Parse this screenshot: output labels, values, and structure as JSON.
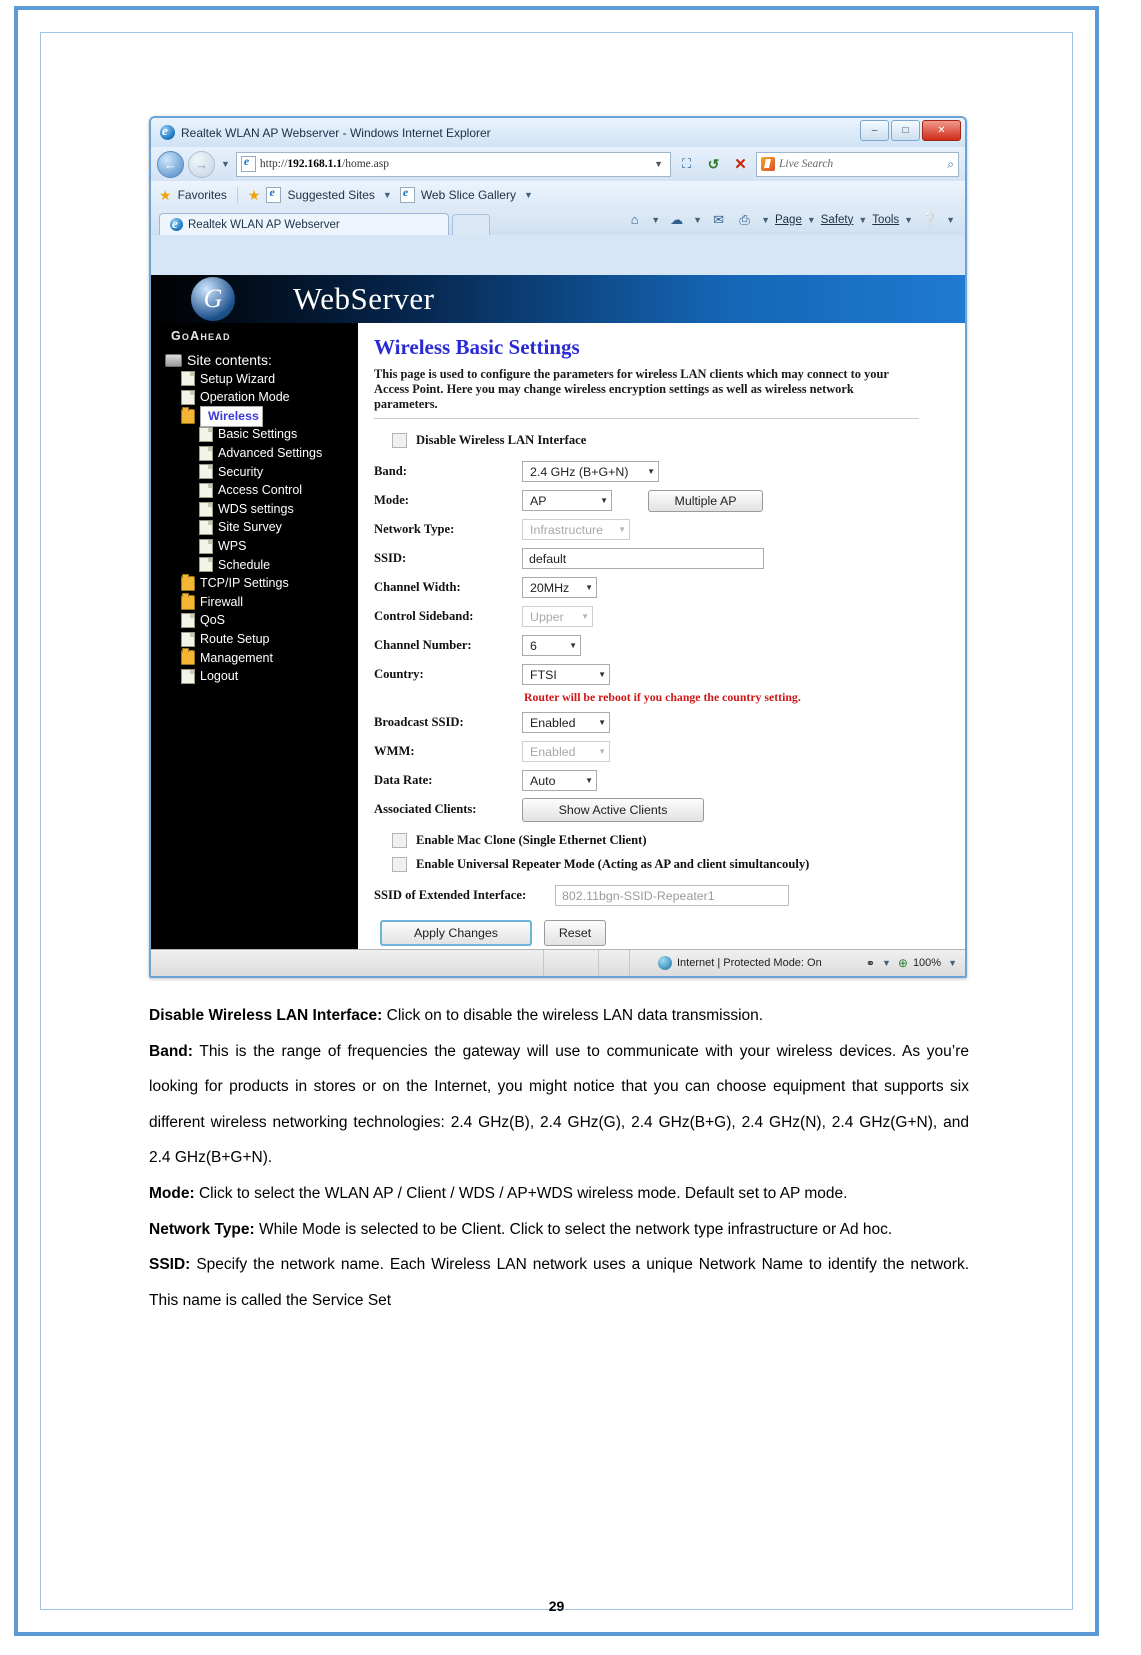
{
  "browser": {
    "window_title": "Realtek WLAN AP Webserver - Windows Internet Explorer",
    "minimize_label": "–",
    "maximize_label": "□",
    "close_label": "✕",
    "back_label": "←",
    "forward_label": "→",
    "url": "http://192.168.1.1/home.asp",
    "url_host": "192.168.1.1",
    "url_prefix": "http://",
    "url_path": "/home.asp",
    "compat_icon": "compatibility-view-icon",
    "refresh_label": "↺",
    "stop_label": "✕",
    "search_placeholder": "Live Search",
    "search_go_label": "⌕",
    "favorites_label": "Favorites",
    "suggested_sites_label": "Suggested Sites",
    "web_slice_label": "Web Slice Gallery",
    "tab_label": "Realtek WLAN AP Webserver",
    "commands": [
      "Page",
      "Safety",
      "Tools"
    ],
    "status_text": "Internet | Protected Mode: On",
    "zoom_level": "100%"
  },
  "app": {
    "brand": "GoAhead",
    "header_title": "WebServer",
    "sidebar": {
      "root_label": "Site contents:",
      "items": [
        {
          "label": "Setup Wizard",
          "icon": "document-icon",
          "level": 1,
          "selected": false
        },
        {
          "label": "Operation Mode",
          "icon": "document-icon",
          "level": 1,
          "selected": false
        },
        {
          "label": "Wireless",
          "icon": "folder-icon",
          "level": 1,
          "selected": true
        },
        {
          "label": "Basic Settings",
          "icon": "document-icon",
          "level": 2,
          "selected": false
        },
        {
          "label": "Advanced Settings",
          "icon": "document-icon",
          "level": 2,
          "selected": false
        },
        {
          "label": "Security",
          "icon": "document-icon",
          "level": 2,
          "selected": false
        },
        {
          "label": "Access Control",
          "icon": "document-icon",
          "level": 2,
          "selected": false
        },
        {
          "label": "WDS settings",
          "icon": "document-icon",
          "level": 2,
          "selected": false
        },
        {
          "label": "Site Survey",
          "icon": "document-icon",
          "level": 2,
          "selected": false
        },
        {
          "label": "WPS",
          "icon": "document-icon",
          "level": 2,
          "selected": false
        },
        {
          "label": "Schedule",
          "icon": "document-icon",
          "level": 2,
          "selected": false
        },
        {
          "label": "TCP/IP Settings",
          "icon": "folder-icon",
          "level": 1,
          "selected": false
        },
        {
          "label": "Firewall",
          "icon": "folder-icon",
          "level": 1,
          "selected": false
        },
        {
          "label": "QoS",
          "icon": "document-icon",
          "level": 1,
          "selected": false
        },
        {
          "label": "Route Setup",
          "icon": "document-icon",
          "level": 1,
          "selected": false
        },
        {
          "label": "Management",
          "icon": "folder-icon",
          "level": 1,
          "selected": false
        },
        {
          "label": "Logout",
          "icon": "document-icon",
          "level": 1,
          "selected": false
        }
      ]
    },
    "page": {
      "title": "Wireless Basic Settings",
      "intro": "This page is used to configure the parameters for wireless LAN clients which may connect to your Access Point. Here you may change wireless encryption settings as well as wireless network parameters.",
      "disable_wlan_label": "Disable Wireless LAN Interface",
      "disable_wlan_checked": false,
      "fields": {
        "band_label": "Band:",
        "band_value": "2.4 GHz (B+G+N)",
        "mode_label": "Mode:",
        "mode_value": "AP",
        "multiple_ap_label": "Multiple AP",
        "network_type_label": "Network Type:",
        "network_type_value": "Infrastructure",
        "ssid_label": "SSID:",
        "ssid_value": "default",
        "channel_width_label": "Channel Width:",
        "channel_width_value": "20MHz",
        "control_sideband_label": "Control Sideband:",
        "control_sideband_value": "Upper",
        "channel_number_label": "Channel Number:",
        "channel_number_value": "6",
        "country_label": "Country:",
        "country_value": "FTSI",
        "country_warning": "Router will be reboot if you change the country setting.",
        "broadcast_ssid_label": "Broadcast SSID:",
        "broadcast_ssid_value": "Enabled",
        "wmm_label": "WMM:",
        "wmm_value": "Enabled",
        "data_rate_label": "Data Rate:",
        "data_rate_value": "Auto",
        "associated_clients_label": "Associated Clients:",
        "show_active_clients_label": "Show Active Clients",
        "mac_clone_label": "Enable Mac Clone (Single Ethernet Client)",
        "mac_clone_checked": false,
        "repeater_label": "Enable Universal Repeater Mode (Acting as AP and client simultancouly)",
        "repeater_checked": false,
        "extended_ssid_label": "SSID of Extended Interface:",
        "extended_ssid_placeholder": "802.11bgn-SSID-Repeater1"
      },
      "apply_label": "Apply Changes",
      "reset_label": "Reset"
    }
  },
  "manual": {
    "page_number": "29",
    "paragraphs": [
      {
        "term": "Disable Wireless LAN Interface:",
        "text": " Click on to disable the wireless LAN data transmission."
      },
      {
        "term": "Band:",
        "text": " This is the range of frequencies the gateway will use to communicate with your wireless devices. As you’re looking for products in stores or on the Internet, you might notice that you can choose equipment that supports six different wireless networking technologies: 2.4 GHz(B), 2.4 GHz(G), 2.4 GHz(B+G), 2.4 GHz(N), 2.4 GHz(G+N), and 2.4 GHz(B+G+N)."
      },
      {
        "term": "Mode:",
        "text": " Click to select the WLAN AP / Client / WDS / AP+WDS wireless mode. Default set to AP mode."
      },
      {
        "term": "Network Type:",
        "text": " While Mode is selected to be Client. Click to select the network type infrastructure or Ad hoc."
      },
      {
        "term": "SSID:",
        "text": " Specify the network name. Each Wireless LAN network uses a unique Network Name to identify the network. This name is called the Service Set"
      }
    ]
  }
}
